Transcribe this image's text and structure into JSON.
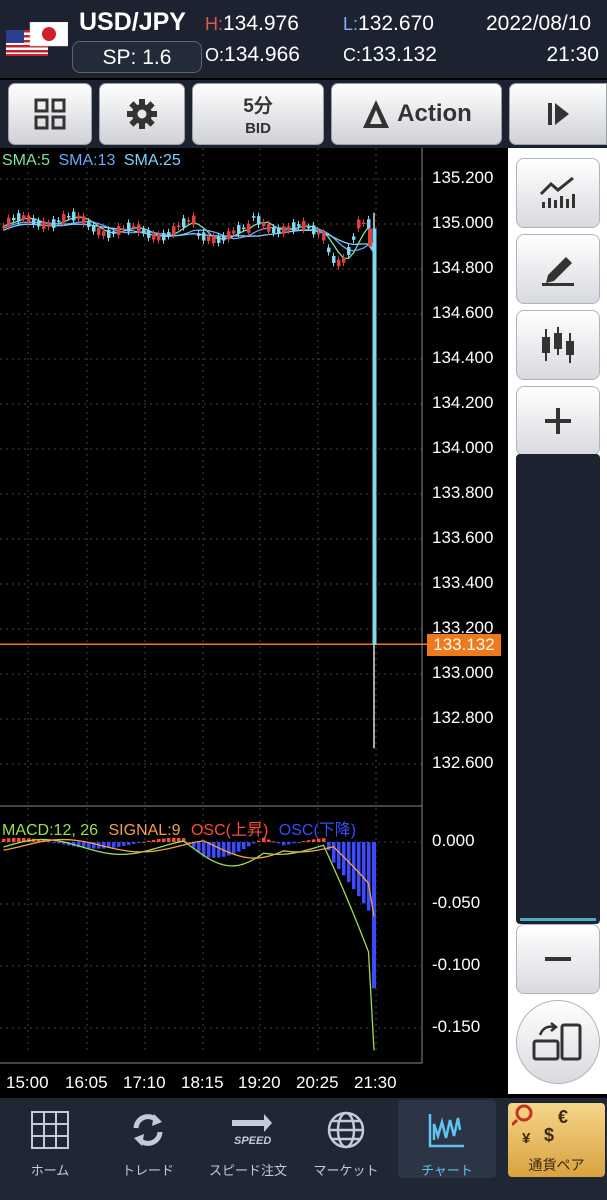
{
  "header": {
    "pair": "USD/JPY",
    "spread": "SP: 1.6",
    "high_key": "H:",
    "high": "134.976",
    "open_key": "O:",
    "open": "134.966",
    "low_key": "L:",
    "low": "132.670",
    "close_key": "C:",
    "close": "133.132",
    "date": "2022/08/10",
    "time": "21:30",
    "high_color": "#e05a4a",
    "low_color": "#7fb2ff"
  },
  "toolbar": {
    "timeframe": "5分",
    "price_type": "BID",
    "action_label": "Action"
  },
  "price_chart": {
    "legend": [
      {
        "label": "SMA:5",
        "color": "#7fe0a0"
      },
      {
        "label": "SMA:13",
        "color": "#6ea6ff"
      },
      {
        "label": "SMA:25",
        "color": "#7fd0ff"
      }
    ],
    "y_ticks": [
      "135.200",
      "135.000",
      "134.800",
      "134.600",
      "134.400",
      "134.200",
      "134.000",
      "133.800",
      "133.600",
      "133.400",
      "133.200",
      "133.000",
      "132.800",
      "132.600"
    ],
    "current_price": "133.132",
    "current_price_color": "#f07a1a"
  },
  "macd_chart": {
    "legend": [
      {
        "label": "MACD:12, 26",
        "color": "#9be04a"
      },
      {
        "label": "SIGNAL:9",
        "color": "#f5a04a"
      },
      {
        "label": "OSC(上昇)",
        "color": "#ff4a3a"
      },
      {
        "label": "OSC(下降)",
        "color": "#3a4aff"
      }
    ],
    "y_ticks": [
      "0.000",
      "-0.050",
      "-0.100",
      "-0.150"
    ]
  },
  "time_axis": [
    "15:00",
    "16:05",
    "17:10",
    "18:15",
    "19:20",
    "20:25",
    "21:30"
  ],
  "chart_data": {
    "type": "candlestick",
    "symbol": "USD/JPY",
    "x": [
      "15:00",
      "16:05",
      "17:10",
      "18:15",
      "19:20",
      "20:25",
      "21:30"
    ],
    "ylim": [
      132.6,
      135.25
    ],
    "last": 133.132,
    "macd_ylim": [
      -0.17,
      0.02
    ]
  },
  "bottom_nav": [
    {
      "label": "ホーム",
      "icon": "grid-icon"
    },
    {
      "label": "トレード",
      "icon": "refresh-arrows-icon"
    },
    {
      "label": "スピード注文",
      "icon": "speed-icon"
    },
    {
      "label": "マーケット",
      "icon": "globe-icon"
    },
    {
      "label": "チャート",
      "icon": "chart-icon"
    },
    {
      "label": "通貨ペア",
      "icon": "currency-pair-icon"
    }
  ]
}
